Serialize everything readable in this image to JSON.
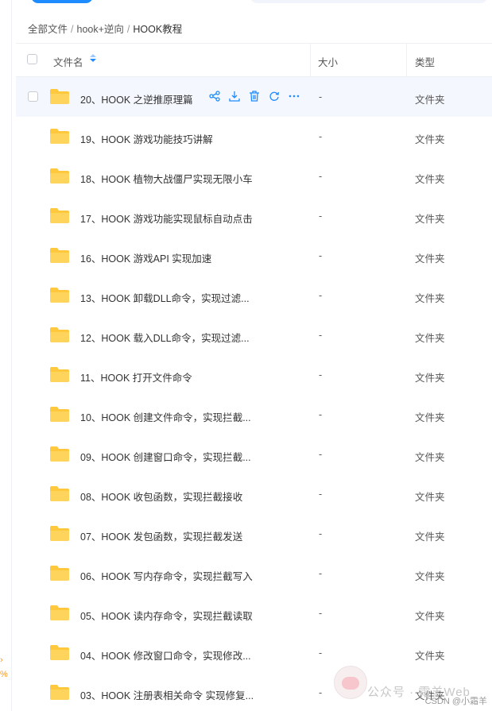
{
  "breadcrumb": {
    "root": "全部文件",
    "sep": "/",
    "parent": "hook+逆向",
    "current": "HOOK教程"
  },
  "table": {
    "headers": {
      "name": "文件名",
      "size": "大小",
      "type": "类型"
    },
    "rows": [
      {
        "name": "20、HOOK 之逆推原理篇",
        "size": "-",
        "type": "文件夹"
      },
      {
        "name": "19、HOOK 游戏功能技巧讲解",
        "size": "-",
        "type": "文件夹"
      },
      {
        "name": "18、HOOK 植物大战僵尸实现无限小车",
        "size": "-",
        "type": "文件夹"
      },
      {
        "name": "17、HOOK 游戏功能实现鼠标自动点击",
        "size": "-",
        "type": "文件夹"
      },
      {
        "name": "16、HOOK 游戏API 实现加速",
        "size": "-",
        "type": "文件夹"
      },
      {
        "name": "13、HOOK 卸载DLL命令，实现过滤...",
        "size": "-",
        "type": "文件夹"
      },
      {
        "name": "12、HOOK 载入DLL命令，实现过滤...",
        "size": "-",
        "type": "文件夹"
      },
      {
        "name": "11、HOOK 打开文件命令",
        "size": "-",
        "type": "文件夹"
      },
      {
        "name": "10、HOOK 创建文件命令，实现拦截...",
        "size": "-",
        "type": "文件夹"
      },
      {
        "name": "09、HOOK 创建窗口命令，实现拦截...",
        "size": "-",
        "type": "文件夹"
      },
      {
        "name": "08、HOOK 收包函数，实现拦截接收",
        "size": "-",
        "type": "文件夹"
      },
      {
        "name": "07、HOOK 发包函数，实现拦截发送",
        "size": "-",
        "type": "文件夹"
      },
      {
        "name": "06、HOOK 写内存命令，实现拦截写入",
        "size": "-",
        "type": "文件夹"
      },
      {
        "name": "05、HOOK 读内存命令，实现拦截读取",
        "size": "-",
        "type": "文件夹"
      },
      {
        "name": "04、HOOK 修改窗口命令，实现修改...",
        "size": "-",
        "type": "文件夹"
      },
      {
        "name": "03、HOOK 注册表相关命令 实现修复...",
        "size": "-",
        "type": "文件夹"
      }
    ]
  },
  "row_actions": [
    "share-icon",
    "download-icon",
    "delete-icon",
    "refresh-icon",
    "more-icon"
  ],
  "watermark": {
    "text": "公众号 · 霜羊Web",
    "csdn": "CSDN @小霜羊"
  },
  "colors": {
    "accent": "#1e8cff",
    "folder": "#ffc83d",
    "hover_row": "#f4f7fd"
  }
}
